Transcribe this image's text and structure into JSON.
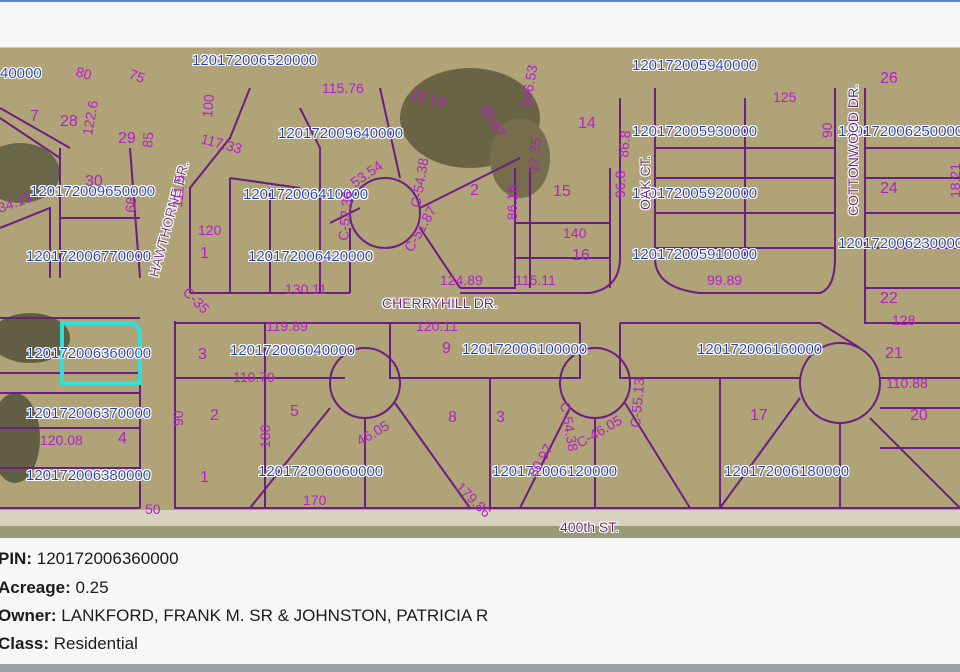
{
  "map": {
    "pins": [
      "120172006520000",
      "120172009640000",
      "120172009650000",
      "120172006410000",
      "120172006770000",
      "120172006420000",
      "120172006360000",
      "120172006040000",
      "120172006100000",
      "120172006160000",
      "120172006370000",
      "120172006380000",
      "120172006060000",
      "120172006120000",
      "120172006180000",
      "120172005940000",
      "120172005930000",
      "120172005920000",
      "120172005910000",
      "120172006250000",
      "120172006230000",
      "40000"
    ],
    "streets": {
      "cherryhill": "CHERRYHILL DR.",
      "hawthorne": "HAWTHORNE DR.",
      "cottonwood": "COTTONWOOD DR.",
      "oak": "OAK CT.",
      "fourhundredth": "400th ST."
    },
    "lot_numbers": [
      "7",
      "28",
      "29",
      "30",
      "1",
      "2",
      "3",
      "5",
      "8",
      "9",
      "14",
      "15",
      "16",
      "17",
      "20",
      "21",
      "22",
      "24",
      "26",
      "1",
      "2",
      "3",
      "4"
    ],
    "dimensions": [
      "115.76",
      "130.11",
      "124.89",
      "115.11",
      "119.89",
      "120.11",
      "110.79",
      "110.88",
      "99.89",
      "179.86",
      "120.08",
      "128",
      "125",
      "140",
      "170",
      "120",
      "180",
      "90",
      "50",
      "86.16",
      "53.54",
      "46.05",
      "C-54.38",
      "C-51.87",
      "C-35",
      "C-46.05",
      "C-54.38",
      "C-55.13",
      "C-52.36",
      "122.6",
      "117.33",
      "111.5",
      "100",
      "85",
      "75",
      "80",
      "68",
      "34.15",
      "80.97",
      "146.53",
      "27.35",
      "12.19",
      "63.87",
      "96.8",
      "18.21",
      "90",
      "86.8"
    ]
  },
  "details": {
    "pin_label": "PIN:",
    "pin_value": "120172006360000",
    "acreage_label": "Acreage:",
    "acreage_value": "0.25",
    "owner_label": "Owner:",
    "owner_value": "LANKFORD, FRANK M. SR & JOHNSTON, PATRICIA R",
    "class_label": "Class:",
    "class_value": "Residential"
  },
  "colors": {
    "parcel_line": "#6a1f82",
    "lot_text": "#b220c8",
    "pin_text": "#1e3fbf",
    "selection": "#2fe0d8",
    "aerial": "#b3a67a"
  }
}
